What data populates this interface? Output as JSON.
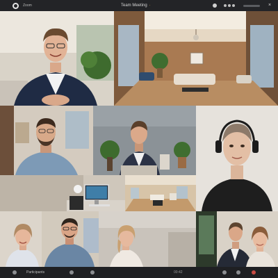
{
  "topbar": {
    "app_name": "Zoom",
    "meeting_title": "Team Meeting",
    "separator": "·",
    "close_glyph": "×",
    "volume_level": 0.75
  },
  "tiles": [
    {
      "name": "participant-tile-presenter",
      "label": ""
    },
    {
      "name": "participant-tile-living-room",
      "label": ""
    },
    {
      "name": "participant-tile-bearded-man",
      "label": ""
    },
    {
      "name": "participant-tile-office-man",
      "label": ""
    },
    {
      "name": "participant-tile-headset-woman",
      "label": ""
    },
    {
      "name": "participant-tile-workspace",
      "label": ""
    },
    {
      "name": "participant-tile-room-view",
      "label": ""
    },
    {
      "name": "participant-tile-woman-smiling",
      "label": ""
    },
    {
      "name": "participant-tile-man-glasses",
      "label": ""
    },
    {
      "name": "participant-tile-woman-blonde",
      "label": ""
    },
    {
      "name": "participant-tile-couple",
      "label": ""
    }
  ],
  "bottombar": {
    "label": "Participants",
    "time": "00:42"
  },
  "colors": {
    "topbar_bg": "#232427",
    "bottombar_bg": "#1f2023",
    "accent": "#e5b13a"
  }
}
